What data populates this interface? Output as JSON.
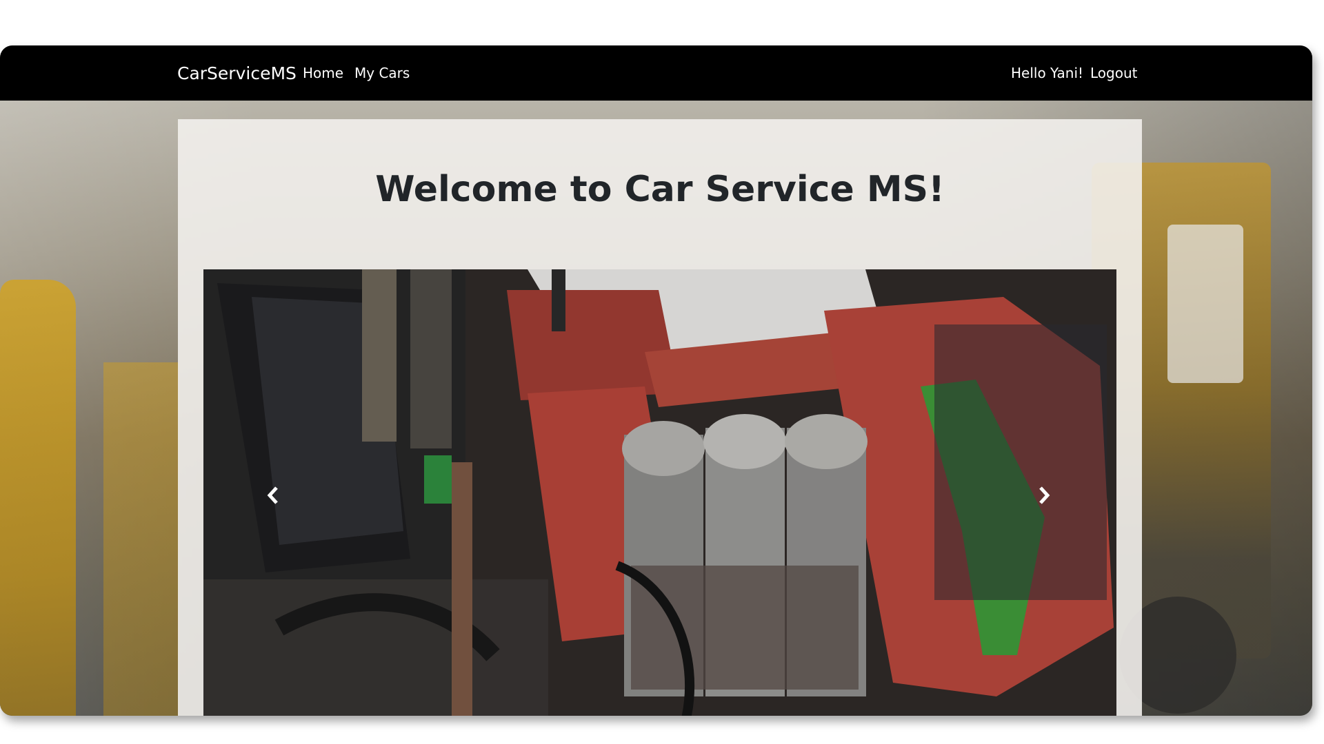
{
  "navbar": {
    "brand": "CarServiceMS",
    "links": [
      "Home",
      "My Cars"
    ],
    "greeting": "Hello Yani!",
    "logout": "Logout"
  },
  "main": {
    "title": "Welcome to Car Service MS!"
  },
  "carousel": {
    "prev_icon": "chevron-left-icon",
    "next_icon": "chevron-right-icon",
    "image_subject": "engine-bay-photo"
  },
  "colors": {
    "navbar_bg": "#000000",
    "panel_bg": "#f2f0ec",
    "title_text": "#212529"
  }
}
